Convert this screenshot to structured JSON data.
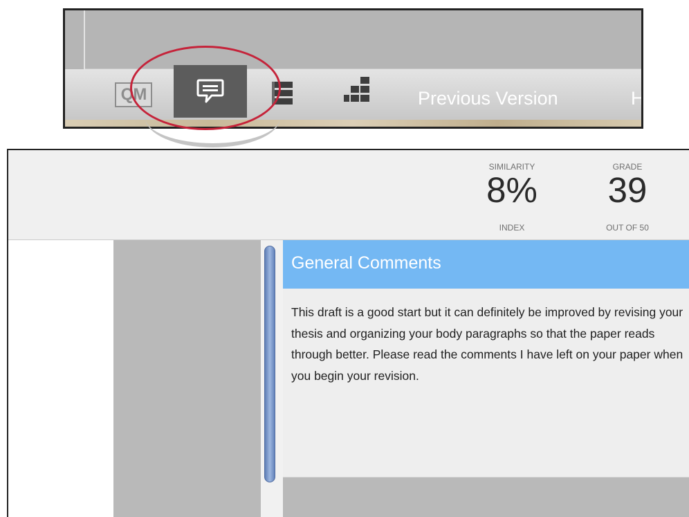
{
  "toolbar": {
    "qm_label": "QM",
    "comment_icon": "speech-bubble-icon",
    "list_icon": "list-icon",
    "grid_icon": "grid-icon",
    "previous_version_label": "Previous Version",
    "truncated_label": "H",
    "highlight_color": "#c5233a",
    "active_tool_color": "#5c5c5c"
  },
  "scores": {
    "similarity": {
      "label": "SIMILARITY",
      "value": "8%",
      "sub": "INDEX"
    },
    "grade": {
      "label": "GRADE",
      "value": "39",
      "sub": "OUT OF 50"
    }
  },
  "comments": {
    "header": "General Comments",
    "header_color": "#74b8f3",
    "text": "This draft is a good start but it can definitely be improved by revising your thesis and organizing your body paragraphs so that the paper reads through better. Please read the comments I have left on your paper when you begin your revision."
  }
}
